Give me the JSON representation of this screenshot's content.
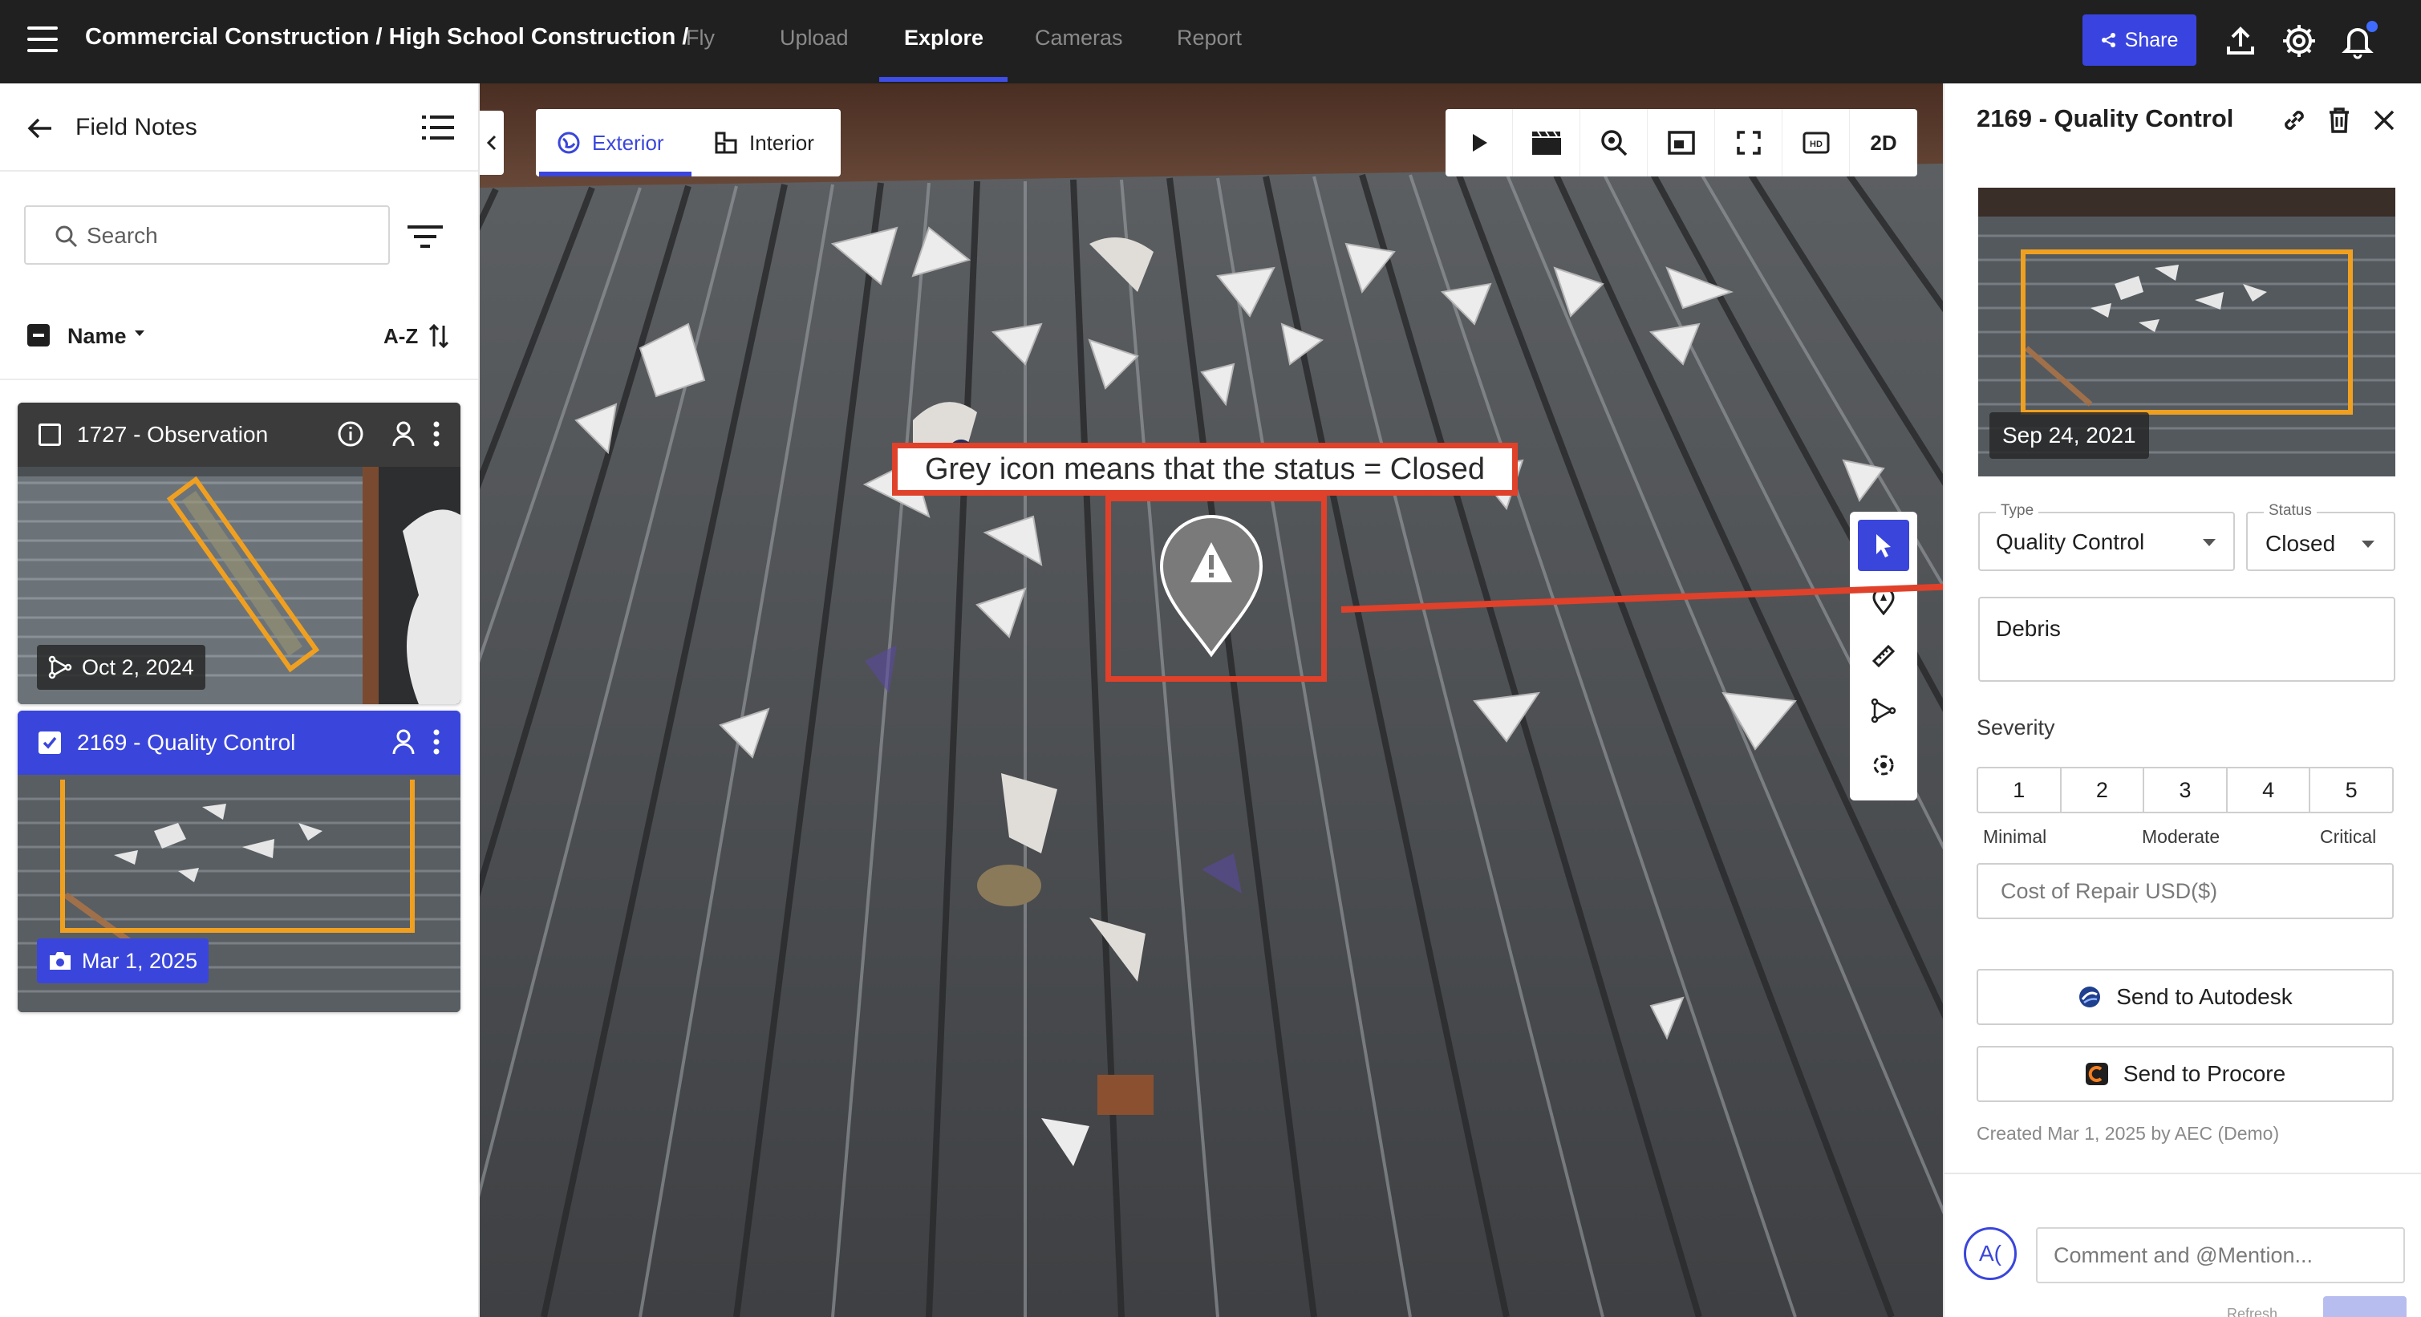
{
  "topbar": {
    "title": "Commercial Construction / High School Construction /",
    "nav": [
      "Fly",
      "Upload",
      "Explore",
      "Cameras",
      "Report"
    ],
    "active_nav": "Explore",
    "share_label": "Share",
    "accent_color": "#3944e0",
    "icons": [
      "menu-icon",
      "share-icon",
      "upload-icon",
      "settings-icon",
      "bell-icon"
    ]
  },
  "left_panel": {
    "title": "Field Notes",
    "search_placeholder": "Search",
    "sort_field": "Name",
    "sort_order": "A-Z",
    "cards": [
      {
        "title": "1727 - Observation",
        "date": "Oct 2, 2024",
        "checked": false,
        "selected": false
      },
      {
        "title": "2169 - Quality Control",
        "date": "Mar 1, 2025",
        "checked": true,
        "selected": true
      }
    ]
  },
  "viewer": {
    "view_tabs": [
      "Exterior",
      "Interior"
    ],
    "active_view": "Exterior",
    "toolbar": [
      "play-icon",
      "clapperboard-icon",
      "zoom-icon",
      "frame-icon",
      "fullscreen-icon",
      "HD",
      "2D"
    ],
    "side_tools": [
      "pointer-icon",
      "location-pin-icon",
      "ruler-icon",
      "path-icon",
      "rotate-icon"
    ],
    "annotation": "Grey icon means that the status = Closed",
    "pin_color": "#7a7a7a",
    "highlight_color": "#e0412a"
  },
  "right_panel": {
    "title": "2169 - Quality Control",
    "photo_date": "Sep 24, 2021",
    "type_label": "Type",
    "type_value": "Quality Control",
    "status_label": "Status",
    "status_value": "Closed",
    "description": "Debris",
    "severity_label": "Severity",
    "severity_options": [
      "1",
      "2",
      "3",
      "4",
      "5"
    ],
    "severity_captions": [
      "Minimal",
      "Moderate",
      "Critical"
    ],
    "cost_placeholder": "Cost of Repair USD($)",
    "send_autodesk": "Send to Autodesk",
    "send_procore": "Send to Procore",
    "created": "Created Mar 1, 2025 by AEC (Demo)",
    "comment_placeholder": "Comment and @Mention...",
    "avatar_initials": "A(",
    "refresh_hint": "Refresh"
  }
}
